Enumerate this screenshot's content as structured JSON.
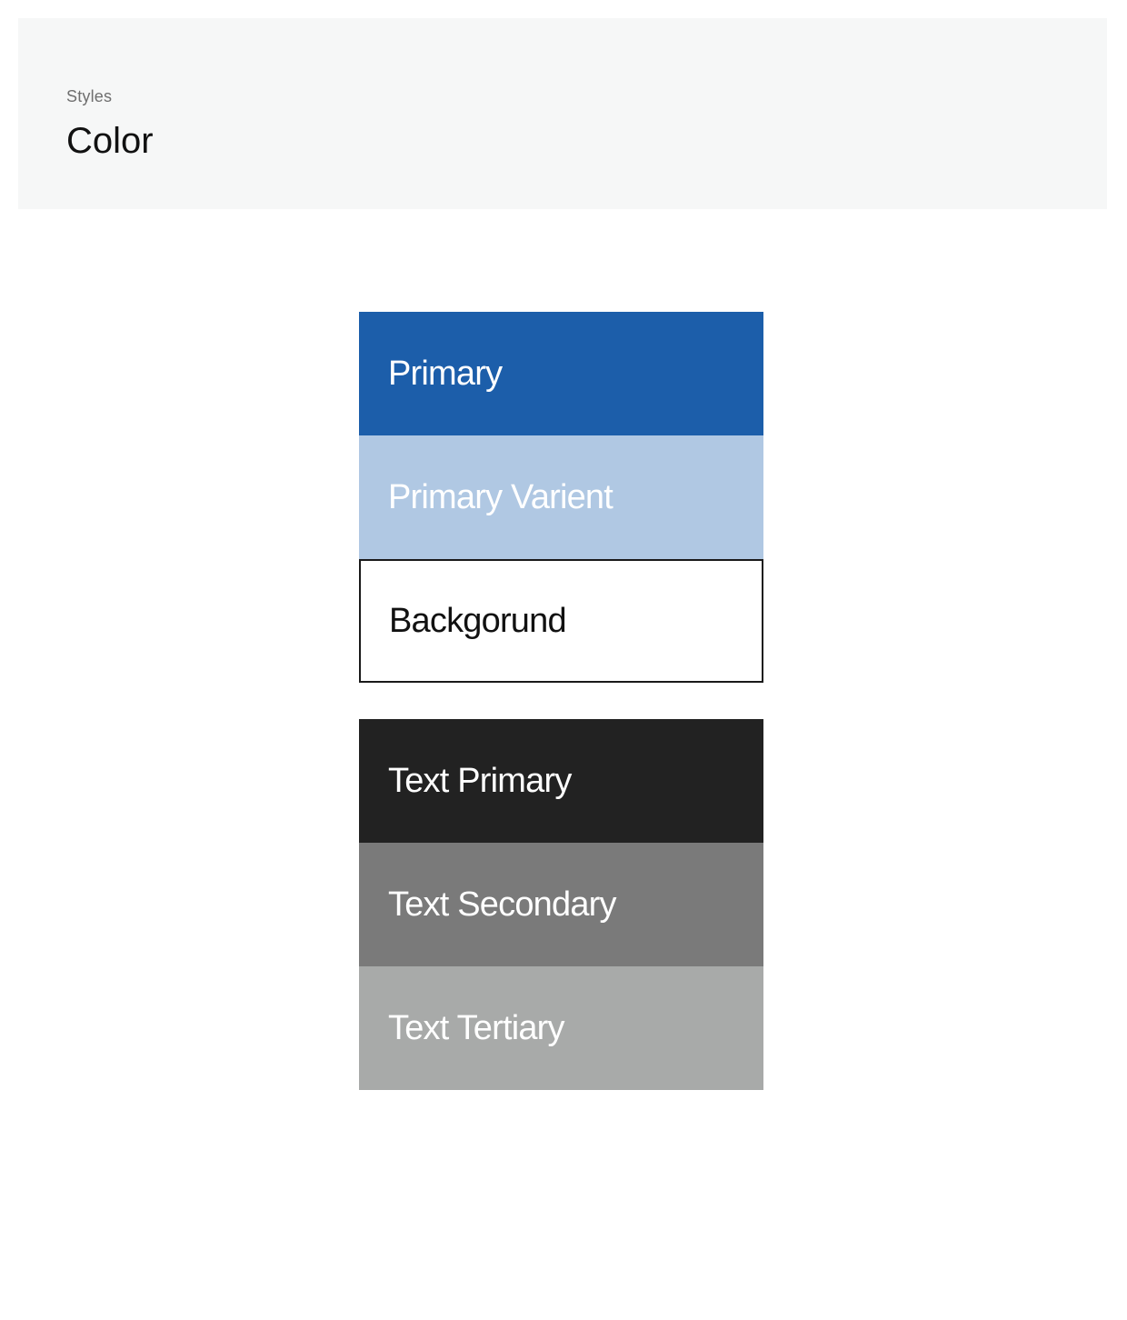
{
  "header": {
    "eyebrow": "Styles",
    "title": "Color"
  },
  "palette": {
    "brand": [
      {
        "label": "Primary",
        "color": "#1c5eaa"
      },
      {
        "label": "Primary Varient",
        "color": "#b0c8e3"
      },
      {
        "label": "Backgorund",
        "color": "#ffffff"
      }
    ],
    "text": [
      {
        "label": "Text Primary",
        "color": "#222222"
      },
      {
        "label": "Text Secondary",
        "color": "#7a7a7a"
      },
      {
        "label": "Text Tertiary",
        "color": "#a8aaa9"
      }
    ]
  }
}
